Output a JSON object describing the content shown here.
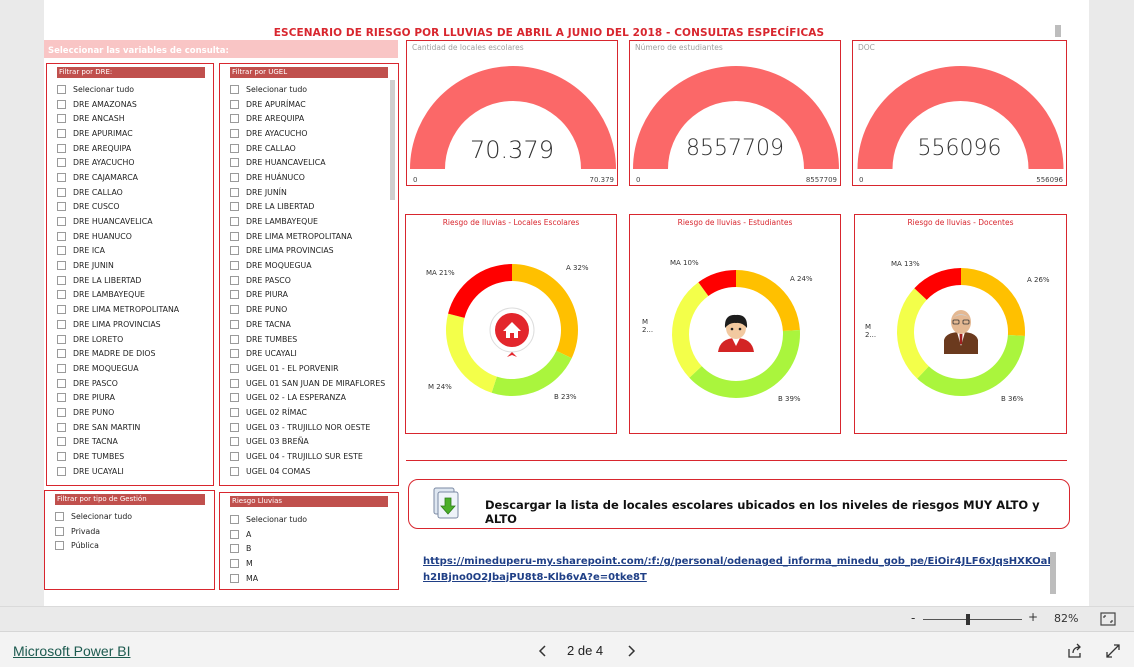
{
  "report": {
    "title": "ESCENARIO DE RIESGO POR LLUVIAS DE ABRIL A JUNIO DEL 2018 - CONSULTAS ESPECÍFICAS",
    "slicer_header": "Seleccionar las variables de consulta:"
  },
  "slicers": {
    "dre": {
      "title": "Filtrar por DRE:",
      "items": [
        "Selecionar tudo",
        "DRE AMAZONAS",
        "DRE ANCASH",
        "DRE APURIMAC",
        "DRE AREQUIPA",
        "DRE AYACUCHO",
        "DRE CAJAMARCA",
        "DRE CALLAO",
        "DRE CUSCO",
        "DRE HUANCAVELICA",
        "DRE HUANUCO",
        "DRE ICA",
        "DRE JUNIN",
        "DRE LA LIBERTAD",
        "DRE LAMBAYEQUE",
        "DRE LIMA METROPOLITANA",
        "DRE LIMA PROVINCIAS",
        "DRE LORETO",
        "DRE MADRE DE DIOS",
        "DRE MOQUEGUA",
        "DRE PASCO",
        "DRE PIURA",
        "DRE PUNO",
        "DRE SAN MARTIN",
        "DRE TACNA",
        "DRE TUMBES",
        "DRE UCAYALI"
      ]
    },
    "ugel": {
      "title": "Filtrar por UGEL",
      "items": [
        "Selecionar tudo",
        "DRE APURÍMAC",
        "DRE AREQUIPA",
        "DRE AYACUCHO",
        "DRE CALLAO",
        "DRE HUANCAVELICA",
        "DRE HUÁNUCO",
        "DRE JUNÍN",
        "DRE LA LIBERTAD",
        "DRE LAMBAYEQUE",
        "DRE LIMA METROPOLITANA",
        "DRE LIMA PROVINCIAS",
        "DRE MOQUEGUA",
        "DRE PASCO",
        "DRE PIURA",
        "DRE PUNO",
        "DRE TACNA",
        "DRE TUMBES",
        "DRE UCAYALI",
        "UGEL 01 - EL PORVENIR",
        "UGEL 01 SAN JUAN DE MIRAFLORES",
        "UGEL 02 - LA ESPERANZA",
        "UGEL 02 RÍMAC",
        "UGEL 03 - TRUJILLO NOR OESTE",
        "UGEL 03 BREÑA",
        "UGEL 04 - TRUJILLO SUR ESTE",
        "UGEL 04 COMAS"
      ]
    },
    "gestion": {
      "title": "Filtrar por tipo de Gestión",
      "items": [
        "Selecionar tudo",
        "Privada",
        "Pública"
      ]
    },
    "riesgo": {
      "title": "Riesgo Lluvias",
      "items": [
        "Selecionar tudo",
        "A",
        "B",
        "M",
        "MA"
      ]
    }
  },
  "gauges": [
    {
      "label": "Cantidad de locales escolares",
      "value": "70.379",
      "min": "0",
      "max": "70.379",
      "fraction": 1.0
    },
    {
      "label": "Número de estudiantes",
      "value": "8557709",
      "min": "0",
      "max": "8557709",
      "fraction": 1.0
    },
    {
      "label": "DOC",
      "value": "556096",
      "min": "0",
      "max": "556096",
      "fraction": 1.0
    }
  ],
  "colors": {
    "accent": "#d8262e",
    "gauge": "#fb6868",
    "ma": "#ff0000",
    "a": "#ffc000",
    "b": "#aaf53d",
    "m": "#f3ff4a"
  },
  "chart_data": [
    {
      "type": "pie",
      "title": "Riesgo de lluvias - Locales Escolares",
      "categories": [
        "A",
        "B",
        "M",
        "MA"
      ],
      "values": [
        32,
        23,
        24,
        21
      ],
      "labels": [
        "A 32%",
        "B 23%",
        "M 24%",
        "MA 21%"
      ],
      "center_icon": "home-icon"
    },
    {
      "type": "pie",
      "title": "Riesgo de lluvias - Estudiantes",
      "categories": [
        "A",
        "B",
        "M",
        "MA"
      ],
      "values": [
        24,
        39,
        27,
        10
      ],
      "labels": [
        "A 24%",
        "B 39%",
        "M 2...",
        "MA 10%"
      ],
      "center_icon": "student-icon"
    },
    {
      "type": "pie",
      "title": "Riesgo de lluvias - Docentes",
      "categories": [
        "A",
        "B",
        "M",
        "MA"
      ],
      "values": [
        26,
        36,
        25,
        13
      ],
      "labels": [
        "A 26%",
        "B 36%",
        "M 2...",
        "MA 13%"
      ],
      "center_icon": "teacher-icon"
    }
  ],
  "download": {
    "text": "Descargar la lista de locales escolares ubicados en los niveles de riesgos MUY ALTO y ALTO"
  },
  "link": {
    "text": "https://mineduperu-my.sharepoint.com/:f:/g/personal/odenaged_informa_minedu_gob_pe/EiOir4JLF6xJqsHXKOaFh2IBjno0O2JbajPU8t8-Klb6vA?e=0tke8T"
  },
  "zoom": {
    "minus": "-",
    "plus": "+",
    "level": "82%",
    "fraction": 0.45
  },
  "footer": {
    "brand": "Microsoft Power BI",
    "page": "2 de 4"
  }
}
